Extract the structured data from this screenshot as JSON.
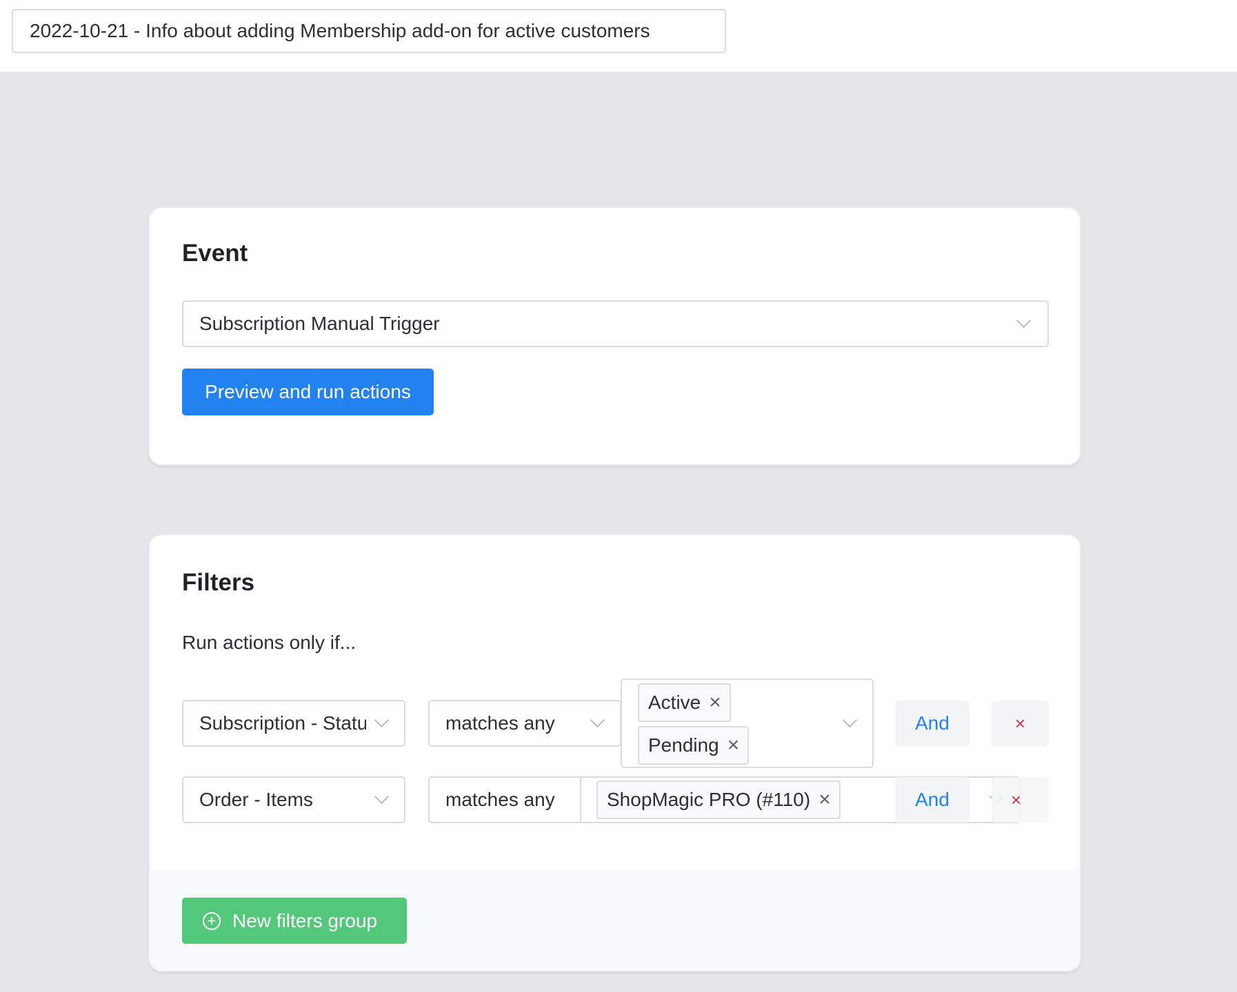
{
  "header": {
    "title_value": "2022-10-21 - Info about adding Membership add-on for active customers"
  },
  "event_card": {
    "heading": "Event",
    "event_select_value": "Subscription Manual Trigger",
    "preview_button_label": "Preview and run actions"
  },
  "filters_card": {
    "heading": "Filters",
    "subtitle": "Run actions only if...",
    "rows": [
      {
        "field": "Subscription - Status",
        "operator": "matches any",
        "values": [
          "Active",
          "Pending"
        ],
        "and_label": "And",
        "remove_label": "×"
      },
      {
        "field": "Order - Items",
        "operator": "matches any",
        "values": [
          "ShopMagic PRO (#110)"
        ],
        "and_label": "And",
        "remove_label": "×"
      }
    ],
    "new_group_button_label": "New filters group"
  },
  "icons": {
    "tag_remove": "×",
    "plus": "+"
  },
  "colors": {
    "primary": "#2282f0",
    "success": "#53c77a",
    "danger": "#d6304f",
    "background": "#e5e6ea"
  }
}
